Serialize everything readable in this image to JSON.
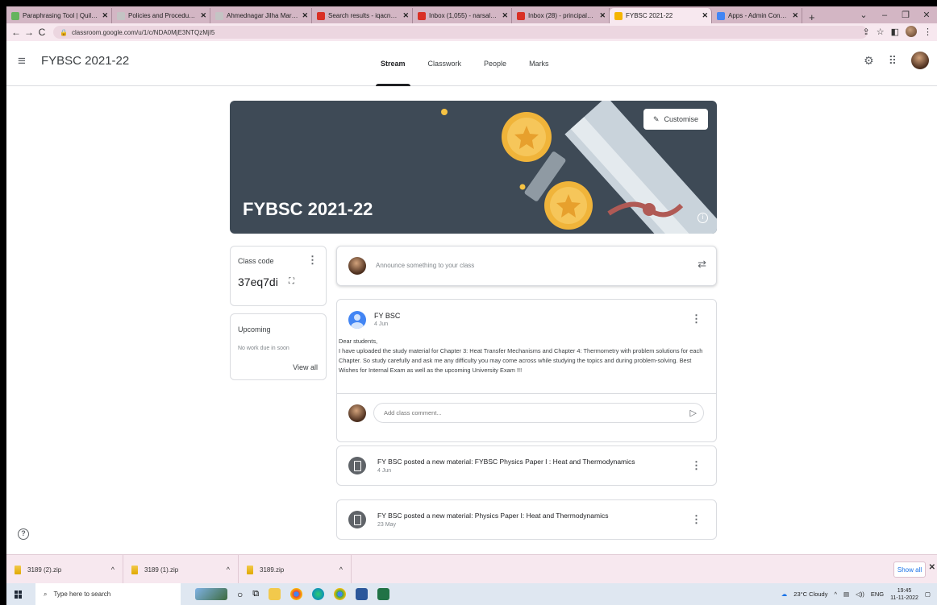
{
  "browser": {
    "tabs": [
      {
        "title": "Paraphrasing Tool | QuillB...",
        "fav": "#64b45c",
        "active": false,
        "width": 131
      },
      {
        "title": "Policies and Procedures - ",
        "fav": "#c4c4c4",
        "active": false,
        "width": 122
      },
      {
        "title": "Ahmednagar Jilha Marathi",
        "fav": "#c4c4c4",
        "active": false,
        "width": 126
      },
      {
        "title": "Search results - iqacnacsp",
        "fav": "#d93025",
        "active": false,
        "width": 125
      },
      {
        "title": "Inbox (1,055) - narsaleraj",
        "fav": "#d93025",
        "active": false,
        "width": 123
      },
      {
        "title": "Inbox (28) - principal@ne",
        "fav": "#d93025",
        "active": false,
        "width": 121
      },
      {
        "title": "FYBSC 2021-22",
        "fav": "#f4b400",
        "active": true,
        "width": 127
      },
      {
        "title": "Apps - Admin Console",
        "fav": "#4285f4",
        "active": false,
        "width": 112
      }
    ],
    "new_tab": "+",
    "url": "classroom.google.com/u/1/c/NDA0MjE3NTQzMjI5"
  },
  "header": {
    "title": "FYBSC 2021-22",
    "nav": [
      {
        "label": "Stream",
        "active": true
      },
      {
        "label": "Classwork",
        "active": false
      },
      {
        "label": "People",
        "active": false
      },
      {
        "label": "Marks",
        "active": false
      }
    ]
  },
  "banner": {
    "title": "FYBSC 2021-22",
    "customise": "Customise"
  },
  "class_code": {
    "label": "Class code",
    "value": "37eq7di"
  },
  "upcoming": {
    "title": "Upcoming",
    "note": "No work due in soon",
    "view_all": "View all"
  },
  "announce": {
    "placeholder": "Announce something to your class"
  },
  "post": {
    "author": "FY BSC",
    "date": "4 Jun",
    "greeting": "Dear students,",
    "body": "I have uploaded the study material for Chapter 3: Heat Transfer Mechanisms and Chapter 4: Thermometry with problem solutions for each Chapter. So study carefully and ask me any difficulty you may come across while studying the topics and during problem-solving. Best Wishes for Internal Exam as well as the upcoming University Exam !!!",
    "comment_placeholder": "Add class comment..."
  },
  "materials": [
    {
      "title": "FY BSC posted a new material: FYBSC Physics Paper I : Heat and Thermodynamics",
      "date": "4 Jun"
    },
    {
      "title": "FY BSC posted a new material: Physics Paper I: Heat and Thermodynamics",
      "date": "23 May"
    }
  ],
  "downloads": {
    "items": [
      "3189 (2).zip",
      "3189 (1).zip",
      "3189.zip"
    ],
    "show_all": "Show all"
  },
  "taskbar": {
    "search": "Type here to search",
    "weather": "23°C  Cloudy",
    "lang": "ENG",
    "time": "19:45",
    "date": "11-11-2022"
  }
}
